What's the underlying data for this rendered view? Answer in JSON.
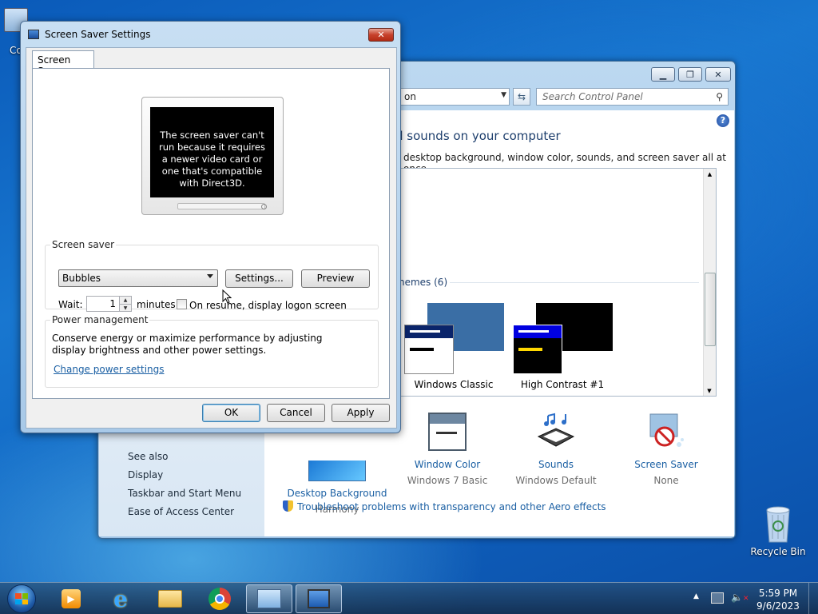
{
  "desktop": {
    "computer_label_partial": "Co",
    "recycle_bin_label": "Recycle Bin"
  },
  "control_panel": {
    "address_partial": "on",
    "search_placeholder": "Search Control Panel",
    "heading_partial": "d sounds on your computer",
    "subheading_partial": "desktop background, window color, sounds, and screen saver all at once.",
    "themes_group_partial": "hemes (6)",
    "themes": [
      {
        "label": "Windows Classic"
      },
      {
        "label": "High Contrast #1"
      }
    ],
    "bottom_items": [
      {
        "title": "Desktop Background",
        "value": "Harmony"
      },
      {
        "title": "Window Color",
        "value": "Windows 7 Basic"
      },
      {
        "title": "Sounds",
        "value": "Windows Default"
      },
      {
        "title": "Screen Saver",
        "value": "None"
      }
    ],
    "see_also": "See also",
    "side_links": [
      "Display",
      "Taskbar and Start Menu",
      "Ease of Access Center"
    ],
    "troubleshoot": "Troubleshoot problems with transparency and other Aero effects"
  },
  "dialog": {
    "title": "Screen Saver Settings",
    "tab": "Screen Saver",
    "preview_message": "The screen saver can't run because it requires a newer video card or one that's compatible with Direct3D.",
    "screen_saver_group": "Screen saver",
    "selected_saver": "Bubbles",
    "settings_btn": "Settings...",
    "preview_btn": "Preview",
    "wait_label": "Wait:",
    "wait_value": "1",
    "minutes_label": "minutes",
    "resume_label": "On resume, display logon screen",
    "power_group": "Power management",
    "power_desc": "Conserve energy or maximize performance by adjusting display brightness and other power settings.",
    "power_link": "Change power settings",
    "ok": "OK",
    "cancel": "Cancel",
    "apply": "Apply"
  },
  "taskbar": {
    "time": "5:59 PM",
    "date": "9/6/2023"
  },
  "colors": {
    "accent_link": "#1a5fa3",
    "close_red": "#c7412c"
  }
}
